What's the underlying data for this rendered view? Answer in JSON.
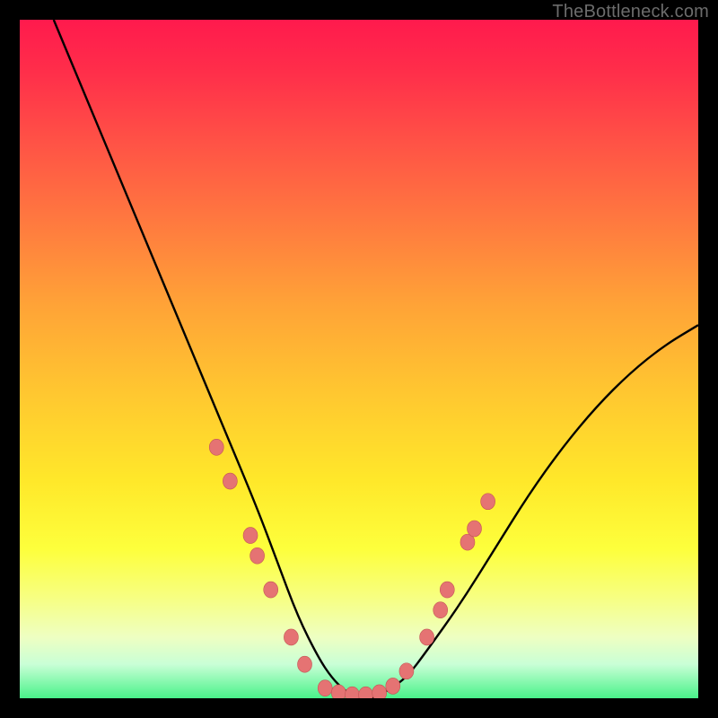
{
  "watermark": "TheBottleneck.com",
  "colors": {
    "background": "#000000",
    "curve": "#000000",
    "marker_fill": "#e57373",
    "marker_stroke": "#c45555",
    "gradient_top": "#ff1a4d",
    "gradient_bottom": "#49f28a"
  },
  "chart_data": {
    "type": "line",
    "title": "",
    "xlabel": "",
    "ylabel": "",
    "xlim": [
      0,
      100
    ],
    "ylim": [
      0,
      100
    ],
    "grid": false,
    "legend": false,
    "annotations": [
      "TheBottleneck.com"
    ],
    "series": [
      {
        "name": "bottleneck-curve",
        "x": [
          5,
          10,
          15,
          20,
          25,
          30,
          35,
          38,
          41,
          44,
          46,
          48,
          50,
          52,
          54,
          57,
          60,
          65,
          70,
          75,
          80,
          85,
          90,
          95,
          100
        ],
        "values": [
          100,
          88,
          76,
          64,
          52,
          40,
          28,
          20,
          12,
          6,
          3,
          1,
          0,
          0,
          1,
          3,
          7,
          14,
          22,
          30,
          37,
          43,
          48,
          52,
          55
        ]
      }
    ],
    "markers": [
      {
        "x": 29,
        "y": 37
      },
      {
        "x": 31,
        "y": 32
      },
      {
        "x": 34,
        "y": 24
      },
      {
        "x": 35,
        "y": 21
      },
      {
        "x": 37,
        "y": 16
      },
      {
        "x": 40,
        "y": 9
      },
      {
        "x": 42,
        "y": 5
      },
      {
        "x": 45,
        "y": 1.5
      },
      {
        "x": 47,
        "y": 0.8
      },
      {
        "x": 49,
        "y": 0.5
      },
      {
        "x": 51,
        "y": 0.5
      },
      {
        "x": 53,
        "y": 0.8
      },
      {
        "x": 55,
        "y": 1.8
      },
      {
        "x": 57,
        "y": 4
      },
      {
        "x": 60,
        "y": 9
      },
      {
        "x": 62,
        "y": 13
      },
      {
        "x": 63,
        "y": 16
      },
      {
        "x": 66,
        "y": 23
      },
      {
        "x": 67,
        "y": 25
      },
      {
        "x": 69,
        "y": 29
      }
    ]
  }
}
